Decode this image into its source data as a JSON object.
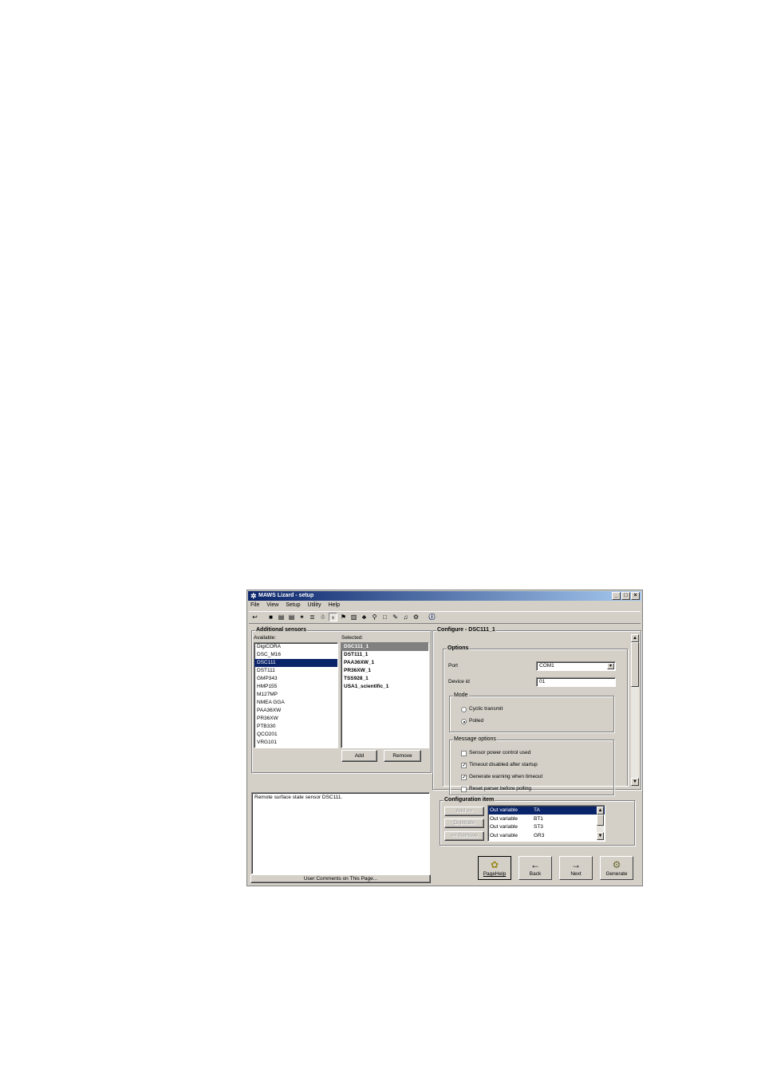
{
  "window": {
    "title": "MAWS Lizard - setup",
    "controls": [
      "_",
      "□",
      "×"
    ]
  },
  "menu": [
    "File",
    "View",
    "Setup",
    "Utility",
    "Help"
  ],
  "toolbar_icons": [
    "back-icon",
    "station-icon",
    "sensor-icon",
    "sensor2-icon",
    "wind-icon",
    "level-icon",
    "person-icon",
    "pressure-icon",
    "flag-icon",
    "log-icon",
    "chart-icon",
    "bike-icon",
    "document-icon",
    "tools-icon",
    "bell-icon",
    "gear-icon",
    "info-icon"
  ],
  "additional_sensors": {
    "title": "Additional sensors",
    "available_label": "Available:",
    "selected_label": "Selected:",
    "available": [
      "DigiCORA",
      "DSC_M16",
      "DSC111",
      "DST111",
      "GMP343",
      "HMP155",
      "M127MP",
      "NMEA GGA",
      "PAA36XW",
      "PR36XW",
      "PTB330",
      "QCO201",
      "VRG101"
    ],
    "available_selected": "DSC111",
    "selected": [
      "DSC111_1",
      "DST111_1",
      "PAA36XW_1",
      "PR36XW_1",
      "TSS928_1",
      "USA1_scientific_1"
    ],
    "selected_highlight": "DSC111_1",
    "add_label": "Add",
    "remove_label": "Remove"
  },
  "description": {
    "text": "Remote surface state sensor DSC111.",
    "comments_label": "User Comments on This Page..."
  },
  "configure": {
    "title": "Configure - DSC111_1",
    "options_title": "Options",
    "port_label": "Port",
    "port_value": "COM1",
    "device_id_label": "Device id",
    "device_id_value": "01",
    "mode_title": "Mode",
    "mode_options": [
      "Cyclic transmit",
      "Polled"
    ],
    "mode_selected": "Polled",
    "message_options_title": "Message options",
    "message_options": [
      {
        "label": "Sensor power control used",
        "checked": false
      },
      {
        "label": "Timeout disabled after startup",
        "checked": true
      },
      {
        "label": "Generate warning when timeout",
        "checked": true
      },
      {
        "label": "Reset parser before polling",
        "checked": false
      }
    ]
  },
  "configuration_item": {
    "title": "Configuration item",
    "add_label": "Add >>",
    "duplicate_label": "Duplicate",
    "remove_label": "<< Remove",
    "rows": [
      {
        "type": "Out variable",
        "name": "TA"
      },
      {
        "type": "Out variable",
        "name": "BT1"
      },
      {
        "type": "Out variable",
        "name": "ST3"
      },
      {
        "type": "Out variable",
        "name": "GR3"
      }
    ]
  },
  "nav": {
    "pagehelp": "PageHelp",
    "back": "Back",
    "next": "Next",
    "generate": "Generate"
  }
}
